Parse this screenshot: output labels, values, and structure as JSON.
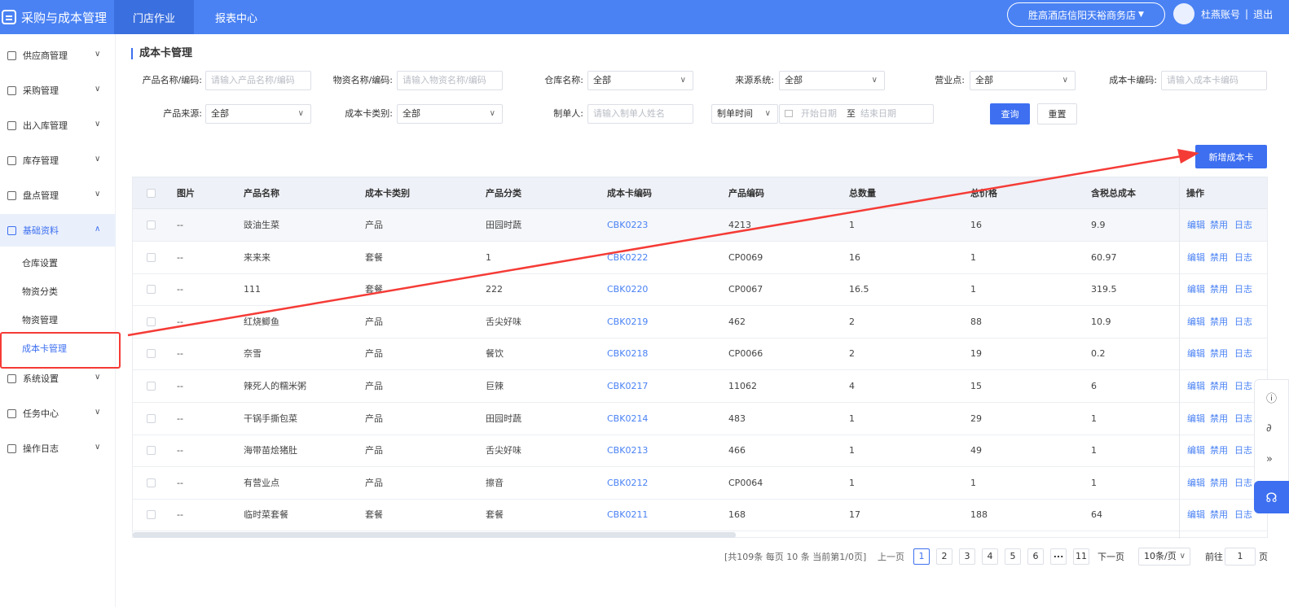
{
  "topbar": {
    "app_title": "采购与成本管理",
    "nav": [
      "门店作业",
      "报表中心"
    ],
    "store": "胜高酒店信阳天裕商务店",
    "username": "杜燕账号",
    "divider": "|",
    "logout": "退出"
  },
  "sidebar": {
    "items": [
      {
        "label": "供应商管理"
      },
      {
        "label": "采购管理"
      },
      {
        "label": "出入库管理"
      },
      {
        "label": "库存管理"
      },
      {
        "label": "盘点管理"
      },
      {
        "label": "基础资料"
      },
      {
        "label": "系统设置"
      },
      {
        "label": "任务中心"
      },
      {
        "label": "操作日志"
      }
    ],
    "sub_items": [
      "仓库设置",
      "物资分类",
      "物资管理",
      "成本卡管理"
    ]
  },
  "page": {
    "title": "成本卡管理",
    "filters": {
      "product_name_label": "产品名称/编码:",
      "product_name_placeholder": "请输入产品名称/编码",
      "material_name_label": "物资名称/编码:",
      "material_name_placeholder": "请输入物资名称/编码",
      "warehouse_label": "仓库名称:",
      "warehouse_value": "全部",
      "source_label": "来源系统:",
      "source_value": "全部",
      "business_point_label": "营业点:",
      "business_point_value": "全部",
      "cost_card_code_label": "成本卡编码:",
      "cost_card_code_placeholder": "请输入成本卡编码",
      "product_source_label": "产品来源:",
      "product_source_value": "全部",
      "card_type_label": "成本卡类别:",
      "card_type_value": "全部",
      "creator_label": "制单人:",
      "creator_placeholder": "请输入制单人姓名",
      "time_type_value": "制单时间",
      "start_date_placeholder": "开始日期",
      "date_sep": "至",
      "end_date_placeholder": "结束日期",
      "query_button": "查询",
      "reset_button": "重置"
    },
    "add_button": "新增成本卡"
  },
  "table": {
    "headers": [
      "图片",
      "产品名称",
      "成本卡类别",
      "产品分类",
      "成本卡编码",
      "产品编码",
      "总数量",
      "总价格",
      "含税总成本",
      "操作"
    ],
    "rows": [
      {
        "img": "--",
        "name": "豉油生菜",
        "type": "产品",
        "cat": "田园时蔬",
        "code": "CBK0223",
        "pcode": "4213",
        "qty": "1",
        "price": "16",
        "cost": "9.9"
      },
      {
        "img": "--",
        "name": "来来来",
        "type": "套餐",
        "cat": "1",
        "code": "CBK0222",
        "pcode": "CP0069",
        "qty": "16",
        "price": "1",
        "cost": "60.97"
      },
      {
        "img": "--",
        "name": "111",
        "type": "套餐",
        "cat": "222",
        "code": "CBK0220",
        "pcode": "CP0067",
        "qty": "16.5",
        "price": "1",
        "cost": "319.5"
      },
      {
        "img": "--",
        "name": "红烧鲫鱼",
        "type": "产品",
        "cat": "舌尖好味",
        "code": "CBK0219",
        "pcode": "462",
        "qty": "2",
        "price": "88",
        "cost": "10.9"
      },
      {
        "img": "--",
        "name": "奈雪",
        "type": "产品",
        "cat": "餐饮",
        "code": "CBK0218",
        "pcode": "CP0066",
        "qty": "2",
        "price": "19",
        "cost": "0.2"
      },
      {
        "img": "--",
        "name": "辣死人的糯米粥",
        "type": "产品",
        "cat": "巨辣",
        "code": "CBK0217",
        "pcode": "11062",
        "qty": "4",
        "price": "15",
        "cost": "6"
      },
      {
        "img": "--",
        "name": "干锅手撕包菜",
        "type": "产品",
        "cat": "田园时蔬",
        "code": "CBK0214",
        "pcode": "483",
        "qty": "1",
        "price": "29",
        "cost": "1"
      },
      {
        "img": "--",
        "name": "海带苗烩猪肚",
        "type": "产品",
        "cat": "舌尖好味",
        "code": "CBK0213",
        "pcode": "466",
        "qty": "1",
        "price": "49",
        "cost": "1"
      },
      {
        "img": "--",
        "name": "有营业点",
        "type": "产品",
        "cat": "擦音",
        "code": "CBK0212",
        "pcode": "CP0064",
        "qty": "1",
        "price": "1",
        "cost": "1"
      },
      {
        "img": "--",
        "name": "临时菜套餐",
        "type": "套餐",
        "cat": "套餐",
        "code": "CBK0211",
        "pcode": "168",
        "qty": "17",
        "price": "188",
        "cost": "64"
      }
    ],
    "ops": [
      "编辑",
      "禁用",
      "日志"
    ]
  },
  "pagination": {
    "summary": "[共109条 每页 10 条 当前第1/0页]",
    "prev": "上一页",
    "pages": [
      "1",
      "2",
      "3",
      "4",
      "5",
      "6",
      "...",
      "11"
    ],
    "next": "下一页",
    "page_size": "10条/页",
    "goto_label": "前往",
    "goto_value": "1",
    "page_unit": "页"
  },
  "colors": {
    "primary": "#4a82f4",
    "annotation": "#f53b36"
  }
}
